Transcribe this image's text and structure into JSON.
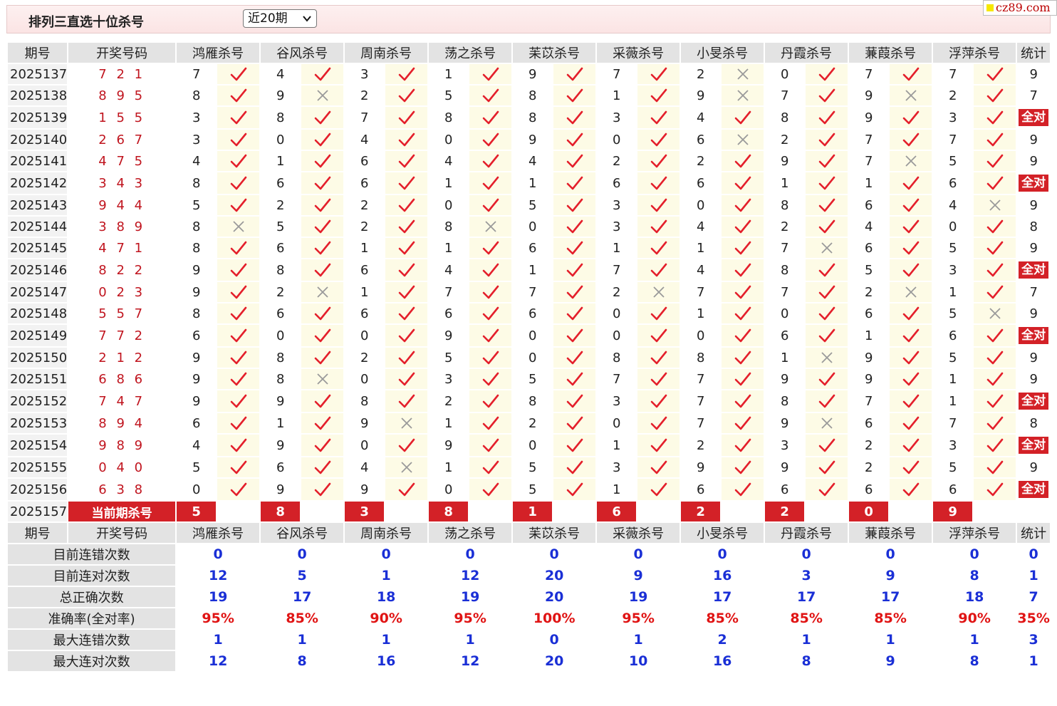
{
  "header": {
    "title": "排列三直选十位杀号",
    "period_select": "近20期"
  },
  "logo": {
    "text": "cz89.com"
  },
  "columns": {
    "period": "期号",
    "draw": "开奖号码",
    "stat": "统计",
    "experts": [
      "鸿雁杀号",
      "谷风杀号",
      "周南杀号",
      "荡之杀号",
      "苿苡杀号",
      "采薇杀号",
      "小旻杀号",
      "丹霞杀号",
      "蒹葭杀号",
      "浮萍杀号"
    ]
  },
  "rows": [
    {
      "period": "2025137",
      "draw": "7 2 1",
      "kills": [
        "7",
        "4",
        "3",
        "1",
        "9",
        "7",
        "2",
        "0",
        "7",
        "7"
      ],
      "marks": [
        "ok",
        "ok",
        "ok",
        "ok",
        "ok",
        "ok",
        "x",
        "ok",
        "ok",
        "ok"
      ],
      "stat": "9"
    },
    {
      "period": "2025138",
      "draw": "8 9 5",
      "kills": [
        "8",
        "9",
        "2",
        "5",
        "8",
        "1",
        "9",
        "7",
        "9",
        "2"
      ],
      "marks": [
        "ok",
        "x",
        "ok",
        "ok",
        "ok",
        "ok",
        "x",
        "ok",
        "x",
        "ok"
      ],
      "stat": "7"
    },
    {
      "period": "2025139",
      "draw": "1 5 5",
      "kills": [
        "3",
        "8",
        "7",
        "8",
        "8",
        "3",
        "4",
        "8",
        "9",
        "3"
      ],
      "marks": [
        "ok",
        "ok",
        "ok",
        "ok",
        "ok",
        "ok",
        "ok",
        "ok",
        "ok",
        "ok"
      ],
      "stat": "全对"
    },
    {
      "period": "2025140",
      "draw": "2 6 7",
      "kills": [
        "3",
        "0",
        "4",
        "0",
        "9",
        "0",
        "6",
        "2",
        "7",
        "7"
      ],
      "marks": [
        "ok",
        "ok",
        "ok",
        "ok",
        "ok",
        "ok",
        "x",
        "ok",
        "ok",
        "ok"
      ],
      "stat": "9"
    },
    {
      "period": "2025141",
      "draw": "4 7 5",
      "kills": [
        "4",
        "1",
        "6",
        "4",
        "4",
        "2",
        "2",
        "9",
        "7",
        "5"
      ],
      "marks": [
        "ok",
        "ok",
        "ok",
        "ok",
        "ok",
        "ok",
        "ok",
        "ok",
        "x",
        "ok"
      ],
      "stat": "9"
    },
    {
      "period": "2025142",
      "draw": "3 4 3",
      "kills": [
        "8",
        "6",
        "6",
        "1",
        "1",
        "6",
        "6",
        "1",
        "1",
        "6"
      ],
      "marks": [
        "ok",
        "ok",
        "ok",
        "ok",
        "ok",
        "ok",
        "ok",
        "ok",
        "ok",
        "ok"
      ],
      "stat": "全对"
    },
    {
      "period": "2025143",
      "draw": "9 4 4",
      "kills": [
        "5",
        "2",
        "2",
        "0",
        "5",
        "3",
        "0",
        "8",
        "6",
        "4"
      ],
      "marks": [
        "ok",
        "ok",
        "ok",
        "ok",
        "ok",
        "ok",
        "ok",
        "ok",
        "ok",
        "x"
      ],
      "stat": "9"
    },
    {
      "period": "2025144",
      "draw": "3 8 9",
      "kills": [
        "8",
        "5",
        "2",
        "8",
        "0",
        "3",
        "4",
        "2",
        "4",
        "0"
      ],
      "marks": [
        "x",
        "ok",
        "ok",
        "x",
        "ok",
        "ok",
        "ok",
        "ok",
        "ok",
        "ok"
      ],
      "stat": "8"
    },
    {
      "period": "2025145",
      "draw": "4 7 1",
      "kills": [
        "8",
        "6",
        "1",
        "1",
        "6",
        "1",
        "1",
        "7",
        "6",
        "5"
      ],
      "marks": [
        "ok",
        "ok",
        "ok",
        "ok",
        "ok",
        "ok",
        "ok",
        "x",
        "ok",
        "ok"
      ],
      "stat": "9"
    },
    {
      "period": "2025146",
      "draw": "8 2 2",
      "kills": [
        "9",
        "8",
        "6",
        "4",
        "1",
        "7",
        "4",
        "8",
        "5",
        "3"
      ],
      "marks": [
        "ok",
        "ok",
        "ok",
        "ok",
        "ok",
        "ok",
        "ok",
        "ok",
        "ok",
        "ok"
      ],
      "stat": "全对"
    },
    {
      "period": "2025147",
      "draw": "0 2 3",
      "kills": [
        "9",
        "2",
        "1",
        "7",
        "7",
        "2",
        "7",
        "7",
        "2",
        "1"
      ],
      "marks": [
        "ok",
        "x",
        "ok",
        "ok",
        "ok",
        "x",
        "ok",
        "ok",
        "x",
        "ok"
      ],
      "stat": "7"
    },
    {
      "period": "2025148",
      "draw": "5 5 7",
      "kills": [
        "8",
        "6",
        "6",
        "6",
        "6",
        "0",
        "1",
        "0",
        "6",
        "5"
      ],
      "marks": [
        "ok",
        "ok",
        "ok",
        "ok",
        "ok",
        "ok",
        "ok",
        "ok",
        "ok",
        "x"
      ],
      "stat": "9"
    },
    {
      "period": "2025149",
      "draw": "7 7 2",
      "kills": [
        "6",
        "0",
        "0",
        "9",
        "0",
        "0",
        "0",
        "6",
        "1",
        "6"
      ],
      "marks": [
        "ok",
        "ok",
        "ok",
        "ok",
        "ok",
        "ok",
        "ok",
        "ok",
        "ok",
        "ok"
      ],
      "stat": "全对"
    },
    {
      "period": "2025150",
      "draw": "2 1 2",
      "kills": [
        "9",
        "8",
        "2",
        "5",
        "0",
        "8",
        "8",
        "1",
        "9",
        "5"
      ],
      "marks": [
        "ok",
        "ok",
        "ok",
        "ok",
        "ok",
        "ok",
        "ok",
        "x",
        "ok",
        "ok"
      ],
      "stat": "9"
    },
    {
      "period": "2025151",
      "draw": "6 8 6",
      "kills": [
        "9",
        "8",
        "0",
        "3",
        "5",
        "7",
        "7",
        "9",
        "9",
        "1"
      ],
      "marks": [
        "ok",
        "x",
        "ok",
        "ok",
        "ok",
        "ok",
        "ok",
        "ok",
        "ok",
        "ok"
      ],
      "stat": "9"
    },
    {
      "period": "2025152",
      "draw": "7 4 7",
      "kills": [
        "9",
        "9",
        "8",
        "2",
        "8",
        "3",
        "7",
        "8",
        "7",
        "1"
      ],
      "marks": [
        "ok",
        "ok",
        "ok",
        "ok",
        "ok",
        "ok",
        "ok",
        "ok",
        "ok",
        "ok"
      ],
      "stat": "全对"
    },
    {
      "period": "2025153",
      "draw": "8 9 4",
      "kills": [
        "6",
        "1",
        "9",
        "1",
        "2",
        "0",
        "7",
        "9",
        "6",
        "7"
      ],
      "marks": [
        "ok",
        "ok",
        "x",
        "ok",
        "ok",
        "ok",
        "ok",
        "x",
        "ok",
        "ok"
      ],
      "stat": "8"
    },
    {
      "period": "2025154",
      "draw": "9 8 9",
      "kills": [
        "4",
        "9",
        "0",
        "9",
        "0",
        "1",
        "2",
        "3",
        "2",
        "3"
      ],
      "marks": [
        "ok",
        "ok",
        "ok",
        "ok",
        "ok",
        "ok",
        "ok",
        "ok",
        "ok",
        "ok"
      ],
      "stat": "全对"
    },
    {
      "period": "2025155",
      "draw": "0 4 0",
      "kills": [
        "5",
        "6",
        "4",
        "1",
        "5",
        "3",
        "9",
        "9",
        "2",
        "5"
      ],
      "marks": [
        "ok",
        "ok",
        "x",
        "ok",
        "ok",
        "ok",
        "ok",
        "ok",
        "ok",
        "ok"
      ],
      "stat": "9"
    },
    {
      "period": "2025156",
      "draw": "6 3 8",
      "kills": [
        "0",
        "9",
        "9",
        "0",
        "5",
        "1",
        "6",
        "6",
        "6",
        "6"
      ],
      "marks": [
        "ok",
        "ok",
        "ok",
        "ok",
        "ok",
        "ok",
        "ok",
        "ok",
        "ok",
        "ok"
      ],
      "stat": "全对"
    }
  ],
  "current": {
    "period": "2025157",
    "label": "当前期杀号",
    "kills": [
      "5",
      "8",
      "3",
      "8",
      "1",
      "6",
      "2",
      "2",
      "0",
      "9"
    ]
  },
  "stats": [
    {
      "label": "目前连错次数",
      "values": [
        "0",
        "0",
        "0",
        "0",
        "0",
        "0",
        "0",
        "0",
        "0",
        "0"
      ],
      "stat": "0",
      "red": false
    },
    {
      "label": "目前连对次数",
      "values": [
        "12",
        "5",
        "1",
        "12",
        "20",
        "9",
        "16",
        "3",
        "9",
        "8"
      ],
      "stat": "1",
      "red": false
    },
    {
      "label": "总正确次数",
      "values": [
        "19",
        "17",
        "18",
        "19",
        "20",
        "19",
        "17",
        "17",
        "17",
        "18"
      ],
      "stat": "7",
      "red": false
    },
    {
      "label": "准确率(全对率)",
      "values": [
        "95%",
        "85%",
        "90%",
        "95%",
        "100%",
        "95%",
        "85%",
        "85%",
        "85%",
        "90%"
      ],
      "stat": "35%",
      "red": true
    },
    {
      "label": "最大连错次数",
      "values": [
        "1",
        "1",
        "1",
        "1",
        "0",
        "1",
        "2",
        "1",
        "1",
        "1"
      ],
      "stat": "3",
      "red": false
    },
    {
      "label": "最大连对次数",
      "values": [
        "12",
        "8",
        "16",
        "12",
        "20",
        "10",
        "16",
        "8",
        "9",
        "8"
      ],
      "stat": "1",
      "red": false
    }
  ],
  "icons": {
    "ok": "check-icon",
    "x": "cross-icon"
  },
  "colors": {
    "check": "#e41f2b",
    "cross": "#9a9a9a",
    "accent_red": "#d32127",
    "stat_blue": "#1a2fd6"
  }
}
